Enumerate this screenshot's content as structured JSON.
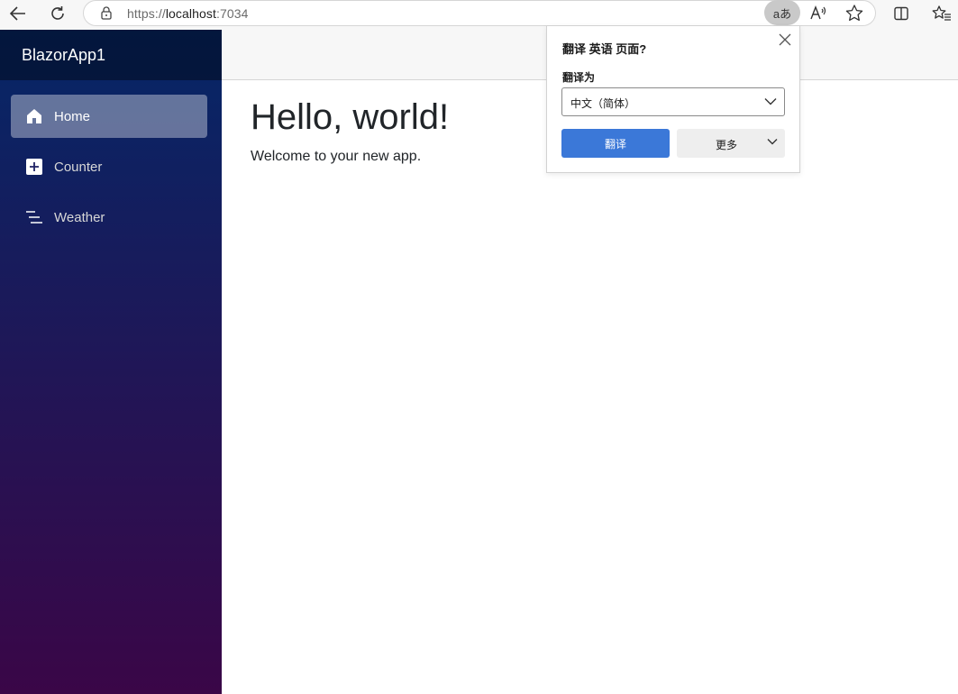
{
  "browser": {
    "url_protocol": "https://",
    "url_host": "localhost",
    "url_port": ":7034",
    "translate_icon_label": "aあ",
    "icons": [
      "back-icon",
      "refresh-icon",
      "lock-icon",
      "translate-icon",
      "read-aloud-icon",
      "favorite-star-icon",
      "split-screen-icon",
      "favorites-icon"
    ]
  },
  "sidebar": {
    "brand": "BlazorApp1",
    "items": [
      {
        "label": "Home",
        "icon": "home-icon",
        "active": true
      },
      {
        "label": "Counter",
        "icon": "plus-square-icon",
        "active": false
      },
      {
        "label": "Weather",
        "icon": "list-icon",
        "active": false
      }
    ]
  },
  "main": {
    "heading": "Hello, world!",
    "welcome": "Welcome to your new app."
  },
  "translate_popup": {
    "title": "翻译 英语 页面?",
    "target_label": "翻译为",
    "target_value": "中文（简体）",
    "translate_button": "翻译",
    "more_button": "更多"
  },
  "colors": {
    "sidebar_top": "#052767",
    "sidebar_bottom": "#3a0647",
    "primary_button": "#3b78d8"
  }
}
